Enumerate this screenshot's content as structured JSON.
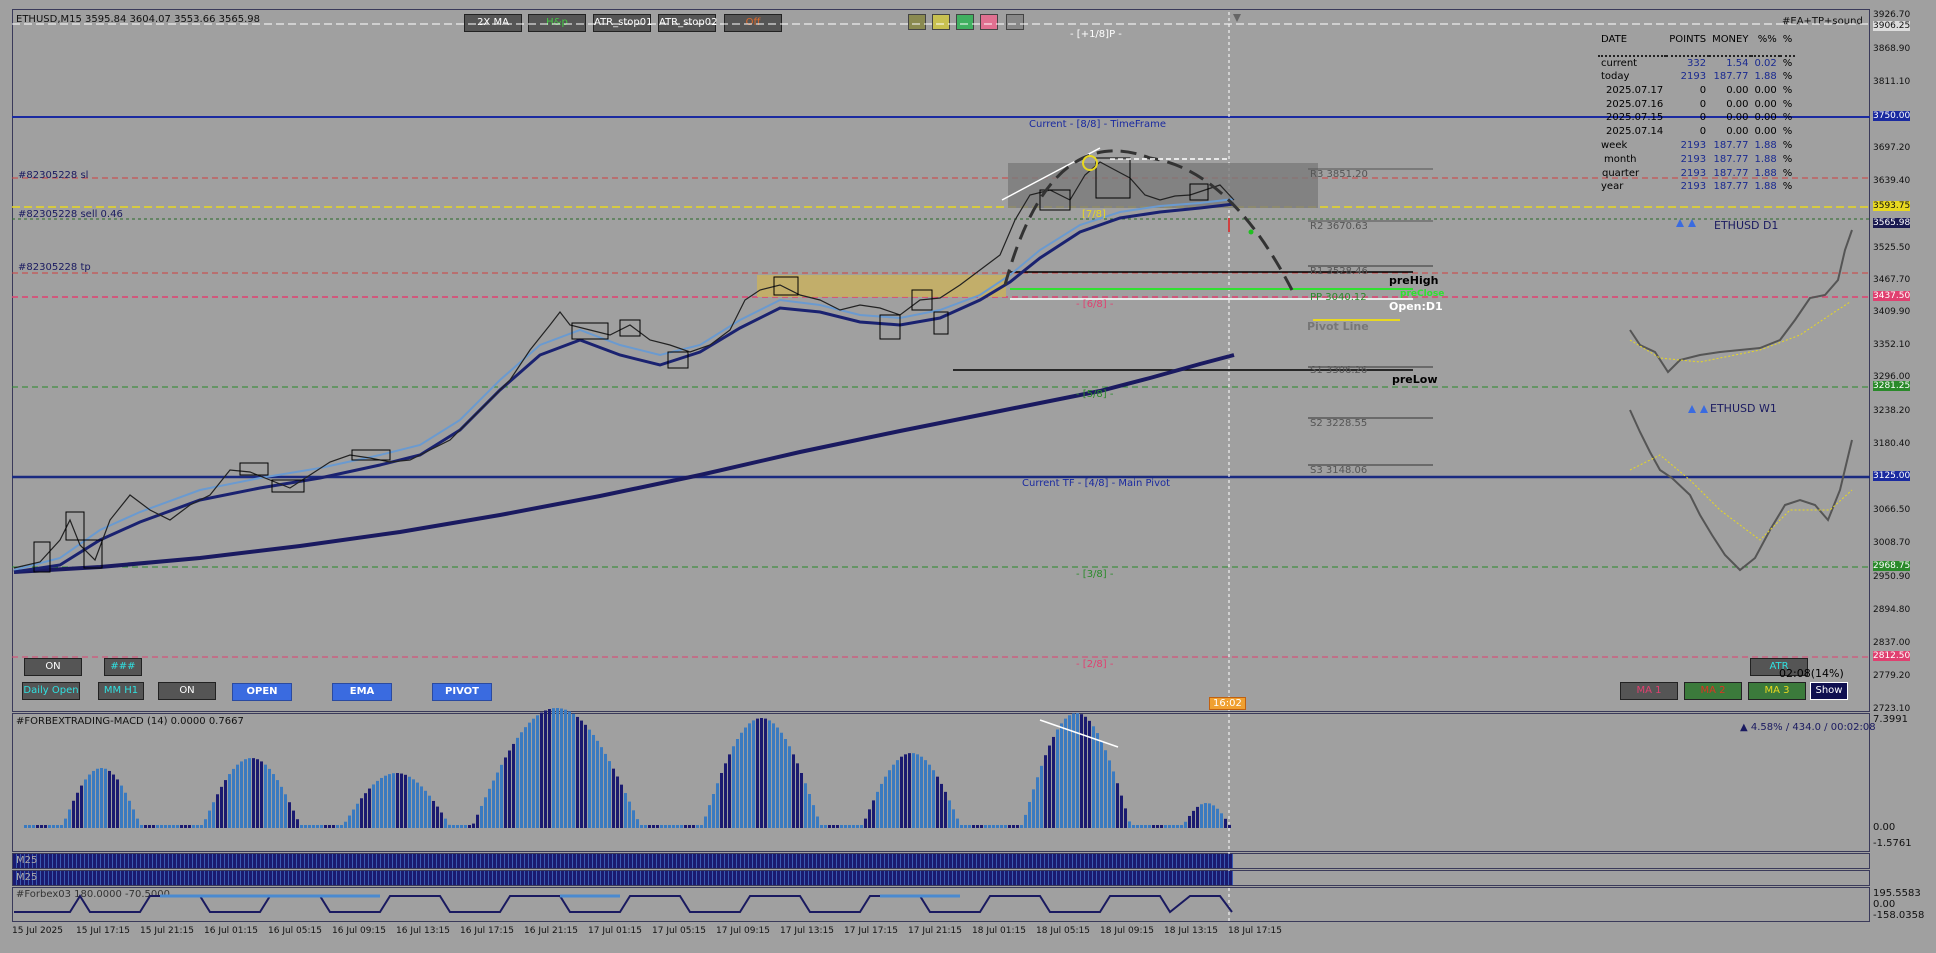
{
  "header": {
    "symbol_info": "ETHUSD,M15  3595.84 3604.07 3553.66 3565.98",
    "ea_label": "#EA+TP+sound",
    "plus_label": "- [+1/8]P -"
  },
  "top_buttons": [
    "2X MA",
    "H&p",
    "ATR_stop01",
    "ATR_stop02",
    "Off"
  ],
  "swatch_colors": [
    "#8a8a50",
    "#c8c050",
    "#40b060",
    "#e07090",
    "#888888"
  ],
  "levels": {
    "current_timeframe": "Current - [8/8] - TimeFrame",
    "main_pivot": "Current TF - [4/8] - Main Pivot",
    "l78": "[7/8]",
    "l68": "- [6/8] -",
    "l58": "- [5/8] -",
    "l38": "- [3/8] -",
    "l28": "- [2/8] -"
  },
  "orders": {
    "sl": "#82305228 sl",
    "sell": "#82305228 sell 0.46",
    "tp": "#82305228 tp"
  },
  "pivots": {
    "r3": "R3 3851.20",
    "r2": "R2 3670.63",
    "r1": "R1 3528.46",
    "pp": "PP 3040.12",
    "s1": "S1 3306.26",
    "s2": "S2 3228.55",
    "s3": "S3 3148.06",
    "prehigh": "preHigh",
    "preclose": "preClose",
    "open_d1": "Open:D1",
    "pivot_line": "Pivot Line",
    "prelow": "preLow"
  },
  "stats": {
    "headers": [
      "DATE",
      "POINTS",
      "MONEY",
      "%%",
      "%"
    ],
    "rows": [
      [
        "current",
        "332",
        "1.54",
        "0.02",
        "%"
      ],
      [
        "today",
        "2193",
        "187.77",
        "1.88",
        "%"
      ],
      [
        "2025.07.17",
        "0",
        "0.00",
        "0.00",
        "%"
      ],
      [
        "2025.07.16",
        "0",
        "0.00",
        "0.00",
        "%"
      ],
      [
        "2025.07.15",
        "0",
        "0.00",
        "0.00",
        "%"
      ],
      [
        "2025.07.14",
        "0",
        "0.00",
        "0.00",
        "%"
      ],
      [
        "week",
        "2193",
        "187.77",
        "1.88",
        "%"
      ],
      [
        "month",
        "2193",
        "187.77",
        "1.88",
        "%"
      ],
      [
        "quarter",
        "2193",
        "187.77",
        "1.88",
        "%"
      ],
      [
        "year",
        "2193",
        "187.77",
        "1.88",
        "%"
      ]
    ]
  },
  "mini_charts": {
    "d1": "ETHUSD  D1",
    "w1": "ETHUSD  W1"
  },
  "bottom_buttons": {
    "on1": "ON",
    "hash": "###",
    "daily_open": "Daily Open",
    "mm_h1": "MM H1",
    "on2": "ON",
    "open": "OPEN",
    "ema": "EMA",
    "pivot": "PIVOT",
    "atr": "ATR",
    "countdown": "02:08(14%)",
    "ma1": "MA 1",
    "ma2": "MA 2",
    "ma3": "MA 3",
    "show": "Show",
    "time_tag": "16:02"
  },
  "price_axis": {
    "labels": [
      "3926.70",
      "3906.25",
      "3868.90",
      "3811.10",
      "3750.00",
      "3697.20",
      "3639.40",
      "3593.75",
      "3565.98",
      "3525.50",
      "3467.70",
      "3437.50",
      "3409.90",
      "3352.10",
      "3296.00",
      "3281.25",
      "3238.20",
      "3180.40",
      "3125.00",
      "3066.50",
      "3008.70",
      "2968.75",
      "2950.90",
      "2894.80",
      "2837.00",
      "2812.50",
      "2779.20",
      "2723.10"
    ],
    "highlight": {
      "3750.00": "#1a2aa0",
      "3593.75": "#e8d820",
      "3565.98": "#1a1a50",
      "3437.50": "#e04070",
      "3281.25": "#2a8a2a",
      "3125.00": "#1a2aa0",
      "2968.75": "#2a8a2a",
      "2812.50": "#e04070"
    }
  },
  "macd": {
    "title": "#FORBEXTRADING-MACD (14) 0.0000 0.7667",
    "info": "▲ 4.58% / 434.0 / 00:02:08",
    "axis": [
      "7.3991",
      "0.00",
      "-1.5761"
    ]
  },
  "sub_indicators": {
    "m25": "M25",
    "m25b": "M25",
    "forbex": "#Forbex03 180.0000 -70.5000",
    "axis": [
      "195.5583",
      "0.00",
      "-158.0358"
    ]
  },
  "time_axis": [
    "15 Jul 2025",
    "15 Jul 17:15",
    "15 Jul 21:15",
    "16 Jul 01:15",
    "16 Jul 05:15",
    "16 Jul 09:15",
    "16 Jul 13:15",
    "16 Jul 17:15",
    "16 Jul 21:15",
    "17 Jul 01:15",
    "17 Jul 05:15",
    "17 Jul 09:15",
    "17 Jul 13:15",
    "17 Jul 17:15",
    "17 Jul 21:15",
    "18 Jul 01:15",
    "18 Jul 05:15",
    "18 Jul 09:15",
    "18 Jul 13:15",
    "18 Jul 17:15"
  ]
}
